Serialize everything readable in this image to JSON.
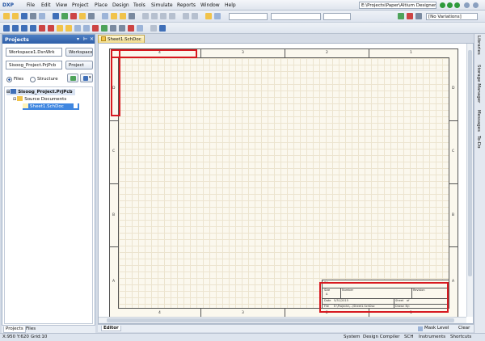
{
  "app": {
    "logo": "DXP",
    "menu": [
      "DXP",
      "File",
      "Edit",
      "View",
      "Project",
      "Place",
      "Design",
      "Tools",
      "Simulate",
      "Reports",
      "Window",
      "Help"
    ],
    "path": "E:\\Projects\\Paper\\Altium Designer",
    "variations": "[No Variations]"
  },
  "projects_panel": {
    "title": "Projects",
    "workspace_name": "Workspace1.DsnWrk",
    "workspace_button": "Workspace",
    "project_name": "Sisoog_Project.PrjPcb",
    "project_button": "Project",
    "view_files": "Files",
    "view_structure": "Structure",
    "tree": {
      "project": "Sisoog_Project.PrjPcb",
      "folder": "Source Documents",
      "document": "Sheet1.SchDoc"
    },
    "tabs": [
      "Projects",
      "Files"
    ]
  },
  "document_tab": "Sheet1.SchDoc",
  "sheet": {
    "top_zones": [
      "4",
      "3",
      "2",
      "1"
    ],
    "side_zones": [
      "D",
      "C",
      "B",
      "A"
    ],
    "title_block": {
      "title": "Title",
      "size_label": "Size",
      "size_value": "A",
      "number_label": "Number",
      "revision_label": "Revision",
      "date_label": "Date",
      "date_value": "5/31/2015",
      "file_label": "File",
      "file_value": "E:\\Projects\\...\\Sheet1.SchDoc",
      "sheet_label": "Sheet",
      "sheet_value": "of",
      "drawn_label": "Drawn By:"
    }
  },
  "editor_bar": {
    "label": "Editor",
    "mask_level": "Mask Level",
    "clear": "Clear"
  },
  "status": {
    "coords": "X:950 Y:620",
    "grid": "Grid:10",
    "items": [
      "System",
      "Design Compiler",
      "SCH",
      "Instruments",
      "Shortcuts"
    ]
  },
  "right_panels": [
    "Libraries",
    "Storage Manager",
    "Messages",
    "To-Do"
  ],
  "colors": {
    "highlight": "#d71920",
    "sheet_bg": "#fbf8ee",
    "panel_header": "#2f5fa8"
  }
}
